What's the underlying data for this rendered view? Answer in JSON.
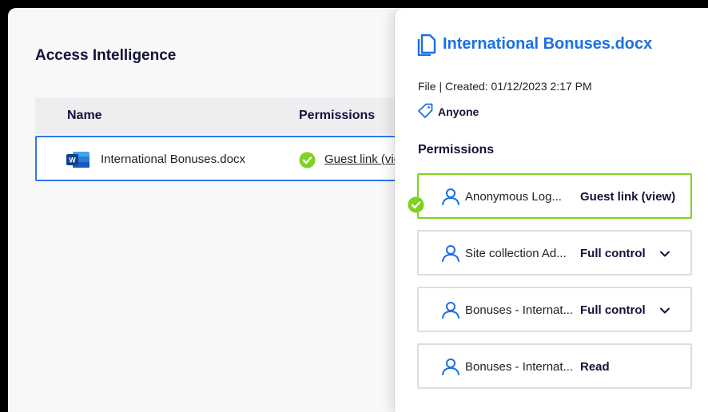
{
  "page": {
    "title": "Access Intelligence"
  },
  "table": {
    "columns": {
      "name": "Name",
      "permissions": "Permissions"
    },
    "row": {
      "file_name": "International Bonuses.docx",
      "permission_link": "Guest link (view)"
    }
  },
  "panel": {
    "file_title": "International Bonuses.docx",
    "meta": "File | Created: 01/12/2023 2:17 PM",
    "sharing_tag": "Anyone",
    "permissions_heading": "Permissions",
    "permissions": [
      {
        "user": "Anonymous Log...",
        "level": "Guest link (view)",
        "expandable": false,
        "highlighted": true
      },
      {
        "user": "Site collection Ad...",
        "level": "Full control",
        "expandable": true,
        "highlighted": false
      },
      {
        "user": "Bonuses - Internat...",
        "level": "Full control",
        "expandable": true,
        "highlighted": false
      },
      {
        "user": "Bonuses - Internat...",
        "level": "Read",
        "expandable": false,
        "highlighted": false
      }
    ]
  },
  "colors": {
    "accent_blue": "#1a6fe6",
    "selection_border": "#2f78e8",
    "success_green": "#7ed321",
    "heading_navy": "#12123b"
  },
  "icons": [
    "word-doc-icon",
    "check-circle-icon",
    "document-icon",
    "tag-icon",
    "user-icon",
    "chevron-down-icon"
  ]
}
